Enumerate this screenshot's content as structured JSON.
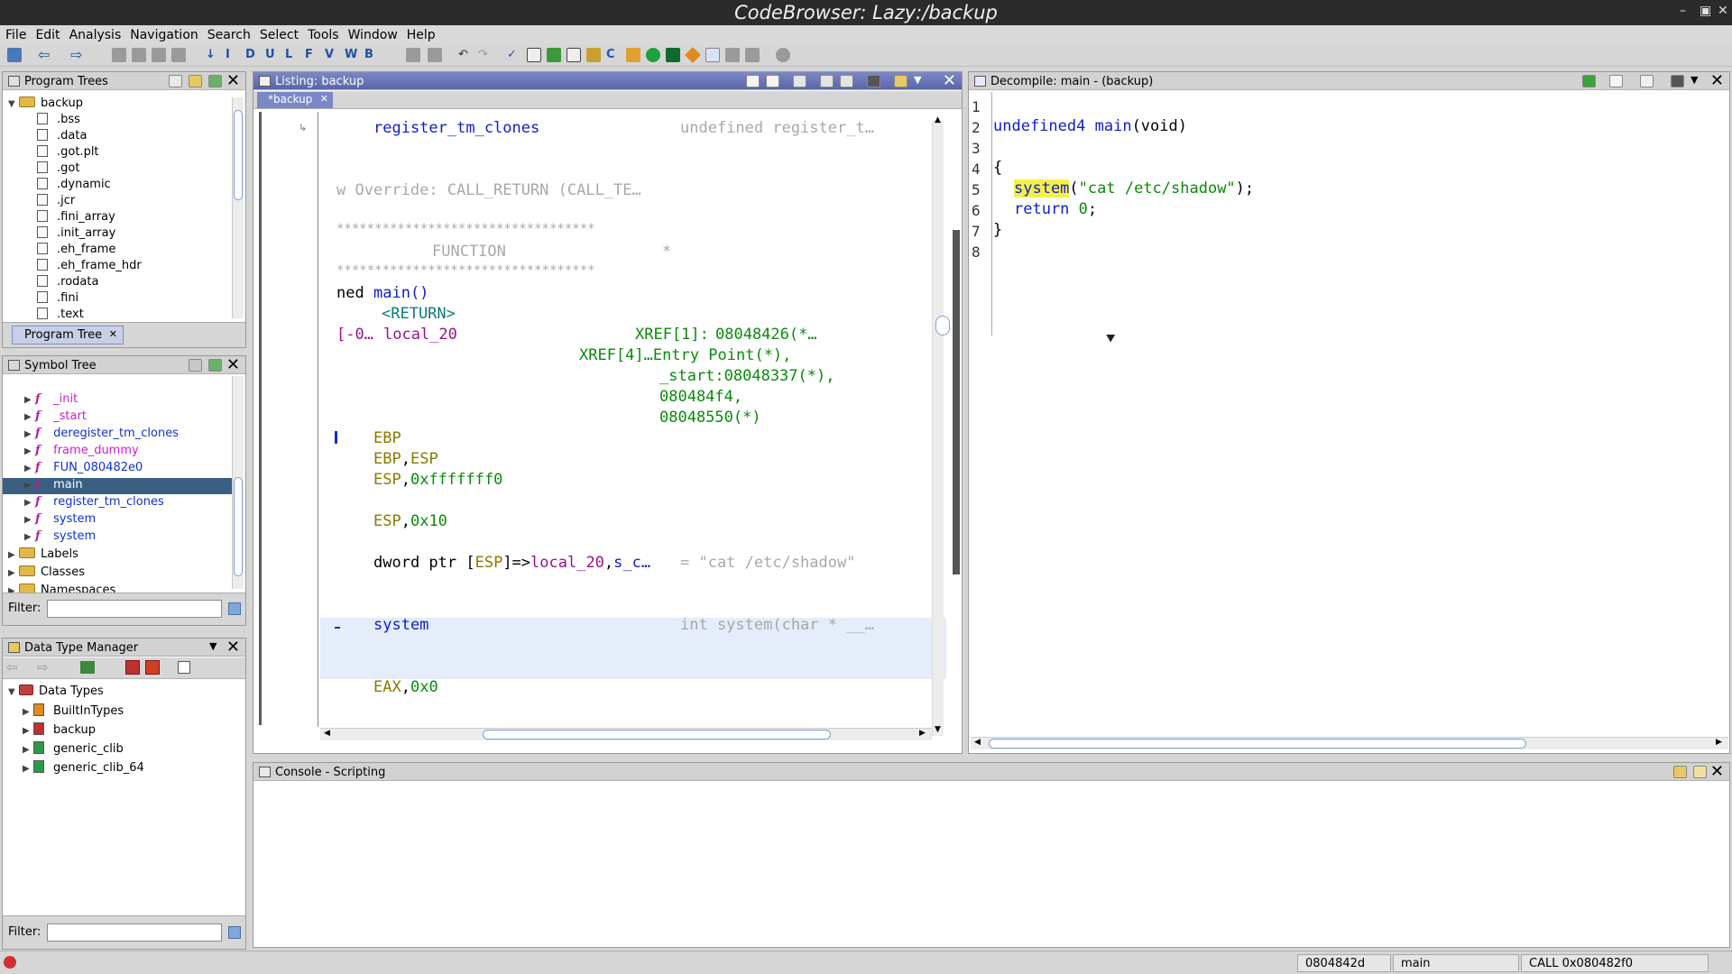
{
  "window": {
    "title": "CodeBrowser: Lazy:/backup"
  },
  "menu": [
    "File",
    "Edit",
    "Analysis",
    "Navigation",
    "Search",
    "Select",
    "Tools",
    "Window",
    "Help"
  ],
  "program_trees": {
    "title": "Program Trees",
    "root": "backup",
    "sections": [
      ".bss",
      ".data",
      ".got.plt",
      ".got",
      ".dynamic",
      ".jcr",
      ".fini_array",
      ".init_array",
      ".eh_frame",
      ".eh_frame_hdr",
      ".rodata",
      ".fini",
      ".text"
    ],
    "tab": "Program Tree"
  },
  "symbol_tree": {
    "title": "Symbol Tree",
    "functions": [
      {
        "name": "_init",
        "style": "pink"
      },
      {
        "name": "_start",
        "style": "pink"
      },
      {
        "name": "deregister_tm_clones",
        "style": "blue"
      },
      {
        "name": "frame_dummy",
        "style": "pink"
      },
      {
        "name": "FUN_080482e0",
        "style": "blue"
      },
      {
        "name": "main",
        "style": "selected"
      },
      {
        "name": "register_tm_clones",
        "style": "blue"
      },
      {
        "name": "system",
        "style": "blue"
      },
      {
        "name": "system",
        "style": "blue"
      }
    ],
    "folders": [
      "Labels",
      "Classes",
      "Namespaces"
    ],
    "filter_label": "Filter:"
  },
  "data_type_manager": {
    "title": "Data Type Manager",
    "root": "Data Types",
    "items": [
      "BuiltInTypes",
      "backup",
      "generic_clib",
      "generic_clib_64"
    ],
    "filter_label": "Filter:"
  },
  "listing": {
    "title": "Listing:  backup",
    "tab": "*backup",
    "lines": {
      "l1_label": "register_tm_clones",
      "l1_comment": "undefined register_t…",
      "l2": "w Override: CALL_RETURN (CALL_TE…",
      "l3": "**********************************",
      "l4a": "FUNCTION",
      "l4b": "*",
      "l5": "**********************************",
      "l6a": "ned",
      "l6b": "main()",
      "l7": "<RETURN>",
      "l8a": "[-0…",
      "l8b": "local_20",
      "l8c": "XREF[1]:",
      "l8d": "08048426(*…",
      "l9": "XREF[4]…Entry Point(*),",
      "l10": "_start:08048337(*),",
      "l11": "080484f4,",
      "l12": "08048550(*)",
      "l13": "EBP",
      "l14a": "EBP",
      "l14b": ",",
      "l14c": "ESP",
      "l15a": "ESP",
      "l15b": ",",
      "l15c": "0xfffffff0",
      "l16a": "ESP",
      "l16b": ",",
      "l16c": "0x10",
      "l17a": "dword ptr [",
      "l17b": "ESP",
      "l17c": "]=>",
      "l17d": "local_20",
      "l17e": ",",
      "l17f": "s_c…",
      "l17g": "= \"cat /etc/shadow\"",
      "l18a": "system",
      "l18b": "int system(char * __…",
      "l19a": "EAX",
      "l19b": ",",
      "l19c": "0x0"
    }
  },
  "decompile": {
    "title": "Decompile: main -  (backup)",
    "line_numbers": [
      "1",
      "2",
      "3",
      "4",
      "5",
      "6",
      "7",
      "8"
    ],
    "code": {
      "sig_type": "undefined4",
      "sig_name": "main",
      "sig_args": "(void)",
      "open": "{",
      "call_name": "system",
      "call_open": "(",
      "call_str": "\"cat /etc/shadow\"",
      "call_close": ");",
      "ret_kw": "return",
      "ret_val": "0",
      "ret_semi": ";",
      "close": "}"
    }
  },
  "console": {
    "title": "Console - Scripting"
  },
  "status": {
    "address": "0804842d",
    "function": "main",
    "instruction": "CALL 0x080482f0"
  },
  "colors": {
    "accent": "#5a66a8",
    "selected_row": "#3a5f82",
    "highlight_line": "#e4edf9"
  }
}
